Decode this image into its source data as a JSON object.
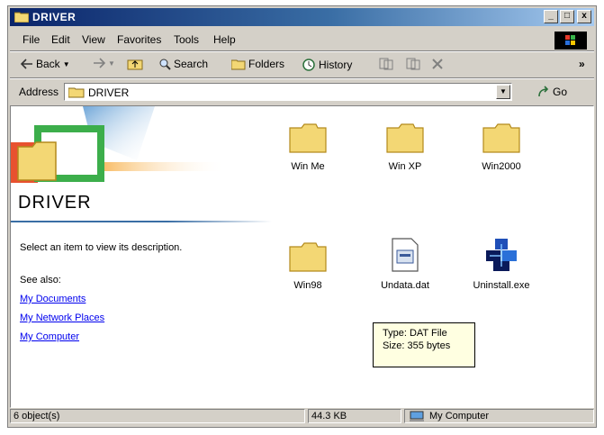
{
  "window": {
    "title": "DRIVER"
  },
  "title_controls": {
    "minimize": "_",
    "maximize": "□",
    "close": "x"
  },
  "menu": {
    "file": "File",
    "edit": "Edit",
    "view": "View",
    "favorites": "Favorites",
    "tools": "Tools",
    "help": "Help"
  },
  "toolbar": {
    "back": "Back",
    "search": "Search",
    "folders": "Folders",
    "history": "History",
    "more": "»"
  },
  "address": {
    "label": "Address",
    "value": "DRIVER",
    "go": "Go"
  },
  "panel": {
    "title": "DRIVER",
    "description": "Select an item to view its description.",
    "see_also": "See also:",
    "links": [
      "My Documents",
      "My Network Places",
      "My Computer"
    ]
  },
  "files": [
    {
      "name": "Win Me",
      "icon": "folder-icon"
    },
    {
      "name": "Win XP",
      "icon": "folder-icon"
    },
    {
      "name": "Win2000",
      "icon": "folder-icon"
    },
    {
      "name": "Win98",
      "icon": "folder-icon"
    },
    {
      "name": "Undata.dat",
      "icon": "dat-file-icon"
    },
    {
      "name": "Uninstall.exe",
      "icon": "exe-file-icon"
    }
  ],
  "tooltip": {
    "type": "Type: DAT File",
    "size": "Size: 355 bytes"
  },
  "status": {
    "objects": "6 object(s)",
    "size": "44.3 KB",
    "zone": "My Computer"
  },
  "colors": {
    "title_start": "#0a246a",
    "title_end": "#a6caf0",
    "face": "#d4d0c8",
    "folder": "#f3d774",
    "link": "#0000ee",
    "tooltip_bg": "#ffffe1"
  }
}
